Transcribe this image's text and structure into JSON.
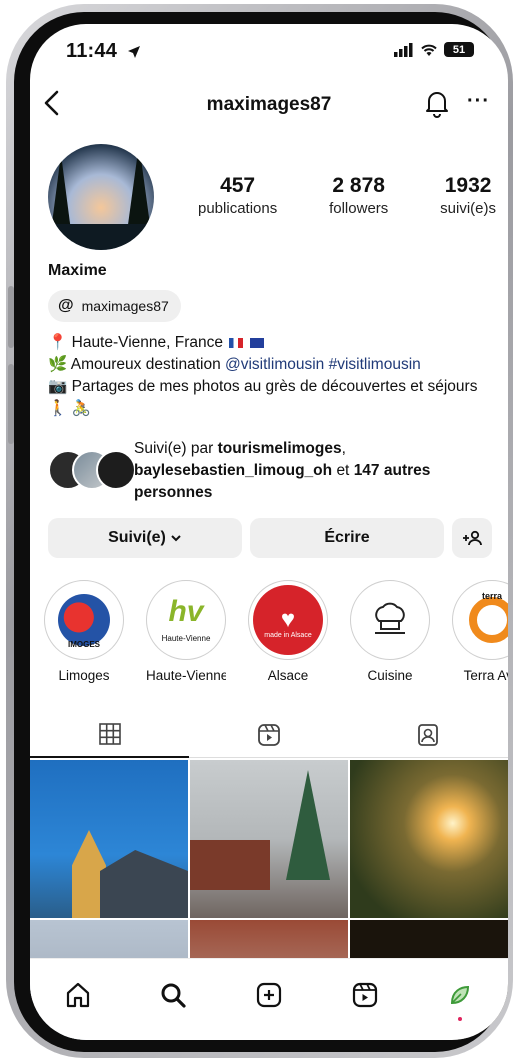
{
  "status_bar": {
    "time": "11:44",
    "battery": "51"
  },
  "header": {
    "username": "maximages87"
  },
  "profile": {
    "stats": [
      {
        "value": "457",
        "label": "publications"
      },
      {
        "value": "2 878",
        "label": "followers"
      },
      {
        "value": "1932",
        "label": "suivi(e)s"
      }
    ],
    "name": "Maxime",
    "threads_handle": "maximages87",
    "bio": {
      "line1": "Haute-Vienne, France",
      "line2_prefix": "Amoureux destination",
      "line2_tag1": "@visitlimousin",
      "line2_tag2": "#visitlimousin",
      "line3": "Partages de mes photos au grès de découvertes et séjours"
    },
    "followed_by": {
      "prefix": "Suivi(e) par",
      "user1": "tourismelimoges",
      "user2": "baylesebastien_limoug_oh",
      "middle": "et",
      "rest": "147 autres personnes"
    }
  },
  "buttons": {
    "follow": "Suivi(e)",
    "message": "Écrire"
  },
  "highlights": [
    {
      "label": "Limoges",
      "badge": "IMOGES"
    },
    {
      "label": "Haute-Vienne",
      "badge": "Haute-Vienne"
    },
    {
      "label": "Alsace",
      "badge": "made in Alsace"
    },
    {
      "label": "Cuisine",
      "badge": ""
    },
    {
      "label": "Terra Ave",
      "badge": "terra"
    }
  ],
  "colors": {
    "link": "#203a78",
    "accent_dot": "#e0245e",
    "alsace_red": "#d6232a"
  }
}
